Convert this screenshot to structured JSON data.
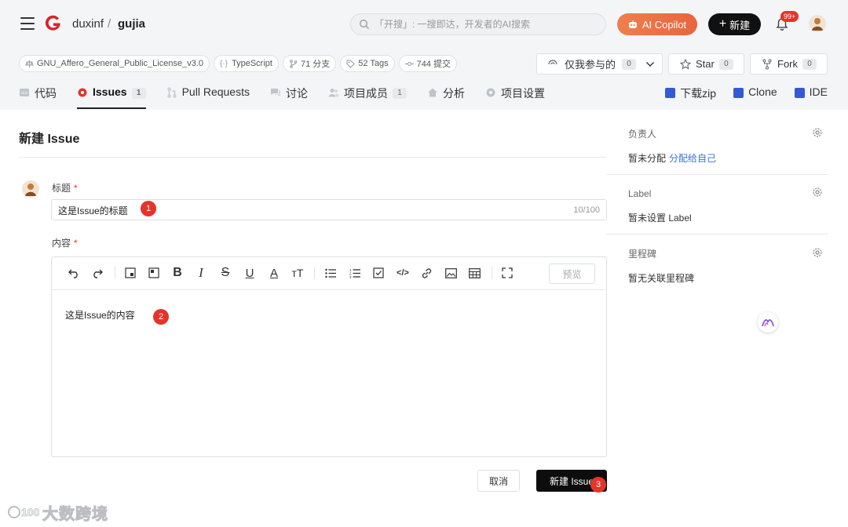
{
  "header": {
    "repo_owner": "duxinf",
    "separator": "/",
    "repo_name": "gujia",
    "search_placeholder": "「开搜」: 一搜即达，开发者的AI搜索",
    "copilot_label": "AI Copilot",
    "new_label": "新建",
    "notification_badge": "99+"
  },
  "repo_meta": {
    "license": "GNU_Affero_General_Public_License_v3.0",
    "language": "TypeScript",
    "branches": "71 分支",
    "tags": "52 Tags",
    "commits": "744 提交"
  },
  "repo_actions": {
    "watch_label": "仅我参与的",
    "watch_count": "0",
    "star_label": "Star",
    "star_count": "0",
    "fork_label": "Fork",
    "fork_count": "0"
  },
  "tabs": [
    {
      "label": "代码",
      "count": ""
    },
    {
      "label": "Issues",
      "count": "1"
    },
    {
      "label": "Pull Requests",
      "count": ""
    },
    {
      "label": "讨论",
      "count": ""
    },
    {
      "label": "项目成员",
      "count": "1"
    },
    {
      "label": "分析",
      "count": ""
    },
    {
      "label": "项目设置",
      "count": ""
    }
  ],
  "tools": {
    "download": "下载zip",
    "clone": "Clone",
    "ide": "IDE"
  },
  "form": {
    "page_title": "新建 Issue",
    "title_label": "标题",
    "required_mark": "*",
    "title_value": "这是Issue的标题",
    "title_counter": "10/100",
    "content_label": "内容",
    "content_value": "这是Issue的内容",
    "preview_label": "预览",
    "cancel_label": "取消",
    "submit_label": "新建 Issue"
  },
  "steps": [
    "1",
    "2",
    "3"
  ],
  "sidebar": {
    "assignee_title": "负责人",
    "assignee_value": "暂未分配",
    "assign_self_link": "分配给自己",
    "label_title": "Label",
    "label_value": "暂未设置 Label",
    "milestone_title": "里程碑",
    "milestone_value": "暂无关联里程碑"
  },
  "watermark": "大数跨境",
  "colors": {
    "accent_red": "#e5342a",
    "copilot_orange": "#ee7449",
    "link_blue": "#3c6fe0",
    "primary_black": "#0d0d0d"
  }
}
